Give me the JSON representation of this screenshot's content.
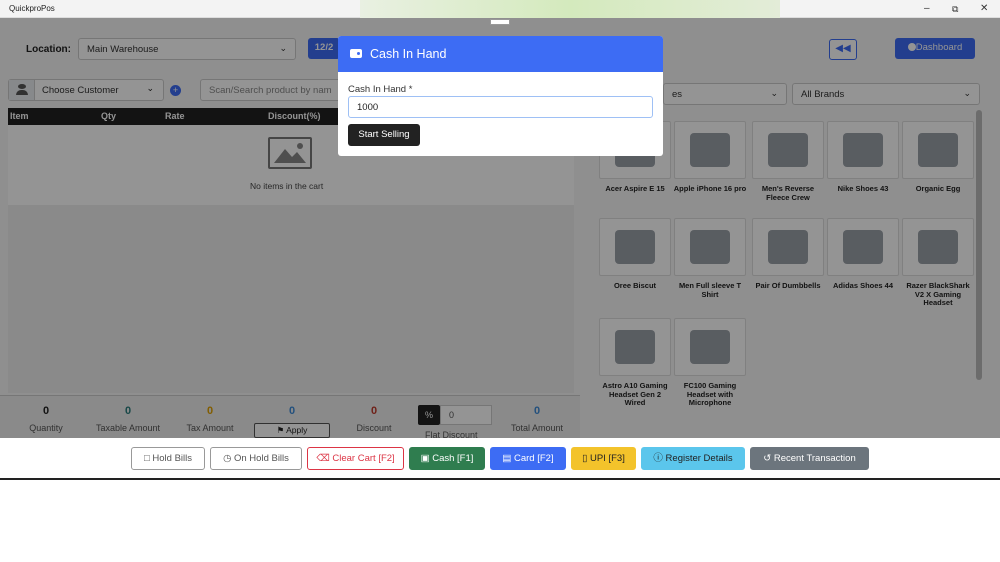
{
  "window": {
    "title": "QuickproPos",
    "minimize": "–",
    "restore": "⧉",
    "close": "✕"
  },
  "header": {
    "location_label": "Location:",
    "location_value": "Main Warehouse",
    "date_partial": "12/2",
    "dashboard_label": "Dashboard"
  },
  "cart": {
    "customer_placeholder": "Choose Customer",
    "search_placeholder": "Scan/Search product by nam",
    "columns": [
      "Item",
      "Qty",
      "Rate",
      "Discount(%)"
    ],
    "empty_text": "No items in the cart"
  },
  "filters": {
    "category_partial": "es",
    "brands": "All Brands"
  },
  "products": [
    {
      "name": "Acer Aspire E 15"
    },
    {
      "name": "Apple iPhone 16 pro"
    },
    {
      "name": "Men's Reverse Fleece Crew"
    },
    {
      "name": "Nike Shoes 43"
    },
    {
      "name": "Organic Egg"
    },
    {
      "name": "Oree Biscut"
    },
    {
      "name": "Men Full sleeve T Shirt"
    },
    {
      "name": "Pair Of Dumbbells"
    },
    {
      "name": "Adidas Shoes 44"
    },
    {
      "name": "Razer BlackShark V2 X Gaming Headset"
    },
    {
      "name": "Astro A10 Gaming Headset Gen 2 Wired"
    },
    {
      "name": "FC100 Gaming Headset with Microphone"
    }
  ],
  "summary": {
    "quantity": {
      "value": "0",
      "label": "Quantity"
    },
    "taxable": {
      "value": "0",
      "label": "Taxable Amount"
    },
    "tax": {
      "value": "0",
      "label": "Tax Amount"
    },
    "apply_value": "0",
    "apply_label": "Apply",
    "discount": {
      "value": "0",
      "label": "Discount"
    },
    "flat_value": "0",
    "flat_label": "Flat Discount",
    "total": {
      "value": "0",
      "label": "Total Amount"
    }
  },
  "footer": {
    "hold_bills": "Hold Bills",
    "on_hold_bills": "On Hold Bills",
    "clear_cart": "Clear Cart [F2]",
    "cash": "Cash [F1]",
    "card": "Card [F2]",
    "upi": "UPI [F3]",
    "register_details": "Register Details",
    "recent_transaction": "Recent Transaction"
  },
  "modal": {
    "title": "Cash In Hand",
    "field_label": "Cash In Hand *",
    "field_value": "1000",
    "submit": "Start Selling"
  },
  "colors": {
    "primary": "#3d6cf4",
    "success": "#2f7d4f",
    "danger": "#dc3545",
    "warning": "#f3c32b",
    "info": "#5bc6ec",
    "secondary": "#6c757d"
  }
}
